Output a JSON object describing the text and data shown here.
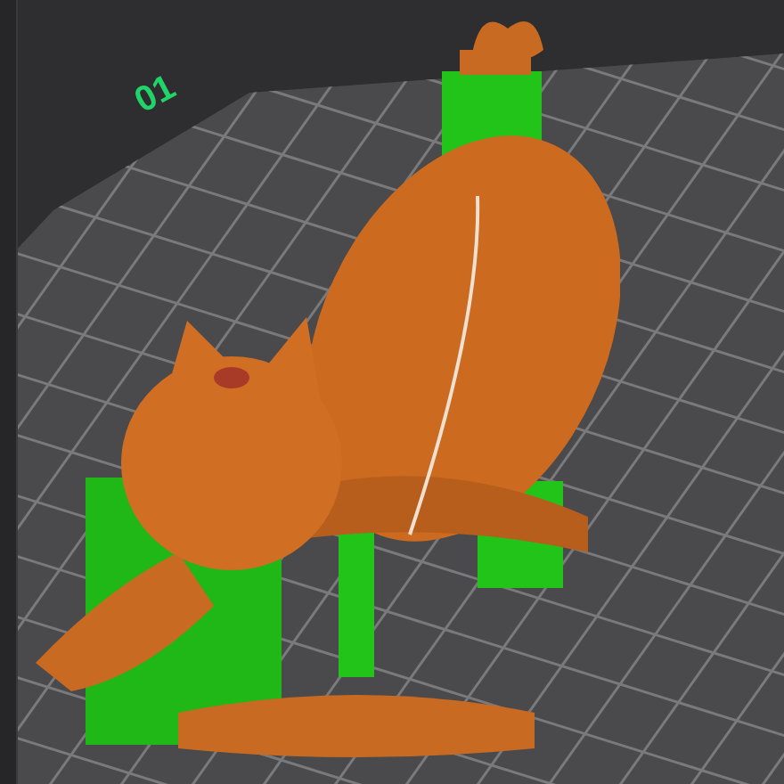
{
  "viewport": {
    "axis_label": "01"
  }
}
